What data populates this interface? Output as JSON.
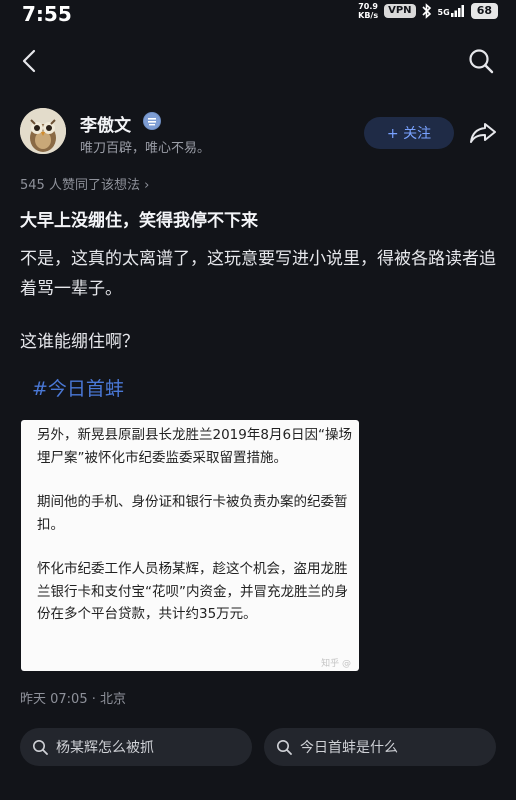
{
  "status_bar": {
    "time": "7:55",
    "net_speed_value": "70.9",
    "net_speed_unit": "KB/s",
    "vpn": "VPN",
    "signal": "5G",
    "battery": "68"
  },
  "nav": {
    "back_icon": "chevron-left-icon",
    "search_icon": "search-icon"
  },
  "author": {
    "name": "李傲文",
    "bio": "唯刀百辟，唯心不易。",
    "follow_label": "+ 关注"
  },
  "post": {
    "likes": "545 人赞同了该想法 ›",
    "title": "大早上没绷住，笑得我停不下来",
    "paragraph1": "不是，这真的太离谱了，这玩意要写进小说里，得被各路读者追着骂一辈子。",
    "paragraph2": "这谁能绷住啊？",
    "hashtag": "#今日首蚌",
    "image_paragraphs": [
      "另外，新晃县原副县长龙胜兰2019年8月6日因“操场埋尸案”被怀化市纪委监委采取留置措施。",
      "期间他的手机、身份证和银行卡被负责办案的纪委暂扣。",
      "怀化市纪委工作人员杨某辉，趁这个机会，盗用龙胜兰银行卡和支付宝“花呗”内资金，并冒充龙胜兰的身份在多个平台贷款，共计约35万元。"
    ],
    "image_watermark": "知乎 @"
  },
  "meta": {
    "time_location": "昨天 07:05 · 北京"
  },
  "suggestions": [
    {
      "label": "杨某辉怎么被抓"
    },
    {
      "label": "今日首蚌是什么"
    }
  ],
  "colors": {
    "background": "#121419",
    "accent": "#4a78d6",
    "follow_text": "#79a2ff"
  }
}
